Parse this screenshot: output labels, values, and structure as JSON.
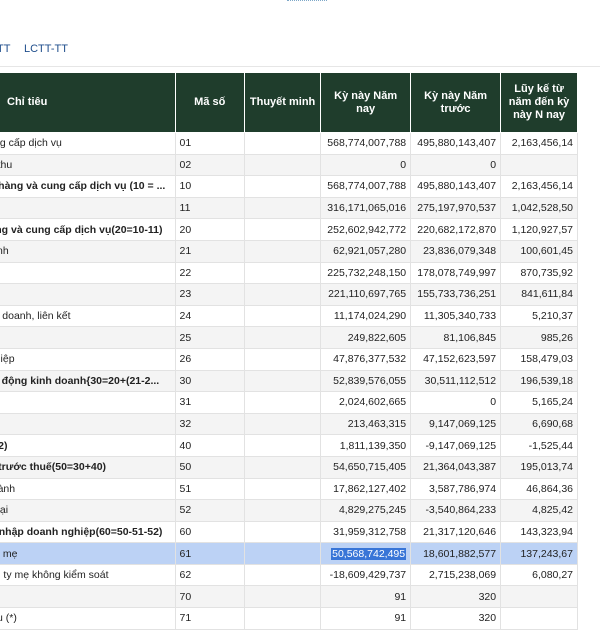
{
  "tabs": [
    "TT",
    "LCTT-TT"
  ],
  "header": {
    "c1": "Chỉ tiêu",
    "c2": "Mã số",
    "c3": "Thuyết minh",
    "c4": "Kỳ này Năm nay",
    "c5": "Kỳ này Năm trước",
    "c6": "Lũy kế từ năm đến kỳ này N nay"
  },
  "rows": [
    {
      "name": "cung cấp dịch vụ",
      "code": "01",
      "note": "",
      "cur": "568,774,007,788",
      "prev": "495,880,143,407",
      "acc": "2,163,456,14",
      "bold": false
    },
    {
      "name": "nh thu",
      "code": "02",
      "note": "",
      "cur": "0",
      "prev": "0",
      "acc": "",
      "bold": false
    },
    {
      "name": "án hàng và cung cấp dịch vụ (10 = ...",
      "code": "10",
      "note": "",
      "cur": "568,774,007,788",
      "prev": "495,880,143,407",
      "acc": "2,163,456,14",
      "bold": true
    },
    {
      "name": "",
      "code": "11",
      "note": "",
      "cur": "316,171,065,016",
      "prev": "275,197,970,537",
      "acc": "1,042,528,50",
      "bold": false
    },
    {
      "name": "hàng và cung cấp dịch vụ(20=10-11)",
      "code": "20",
      "note": "",
      "cur": "252,602,942,772",
      "prev": "220,682,172,870",
      "acc": "1,120,927,57",
      "bold": true
    },
    {
      "name": "chính",
      "code": "21",
      "note": "",
      "cur": "62,921,057,280",
      "prev": "23,836,079,348",
      "acc": "100,601,45",
      "bold": false
    },
    {
      "name": "",
      "code": "22",
      "note": "",
      "cur": "225,732,248,150",
      "prev": "178,078,749,997",
      "acc": "870,735,92",
      "bold": false
    },
    {
      "name": "",
      "code": "23",
      "note": "",
      "cur": "221,110,697,765",
      "prev": "155,733,736,251",
      "acc": "841,611,84",
      "bold": false
    },
    {
      "name": "liên doanh, liên kết",
      "code": "24",
      "note": "",
      "cur": "11,174,024,290",
      "prev": "11,305,340,733",
      "acc": "5,210,37",
      "bold": false
    },
    {
      "name": "",
      "code": "25",
      "note": "",
      "cur": "249,822,605",
      "prev": "81,106,845",
      "acc": "985,26",
      "bold": false
    },
    {
      "name": "nghiệp",
      "code": "26",
      "note": "",
      "cur": "47,876,377,532",
      "prev": "47,152,623,597",
      "acc": "158,479,03",
      "bold": false
    },
    {
      "name": "oạt động kinh doanh{30=20+(21-2...",
      "code": "30",
      "note": "",
      "cur": "52,839,576,055",
      "prev": "30,511,112,512",
      "acc": "196,539,18",
      "bold": true
    },
    {
      "name": "",
      "code": "31",
      "note": "",
      "cur": "2,024,602,665",
      "prev": "0",
      "acc": "5,165,24",
      "bold": false
    },
    {
      "name": "",
      "code": "32",
      "note": "",
      "cur": "213,463,315",
      "prev": "9,147,069,125",
      "acc": "6,690,68",
      "bold": false
    },
    {
      "name": "1-32)",
      "code": "40",
      "note": "",
      "cur": "1,811,139,350",
      "prev": "-9,147,069,125",
      "acc": "-1,525,44",
      "bold": true
    },
    {
      "name": "ần trước thuế(50=30+40)",
      "code": "50",
      "note": "",
      "cur": "54,650,715,405",
      "prev": "21,364,043,387",
      "acc": "195,013,74",
      "bold": true
    },
    {
      "name": "n hành",
      "code": "51",
      "note": "",
      "cur": "17,862,127,402",
      "prev": "3,587,786,974",
      "acc": "46,864,36",
      "bold": false
    },
    {
      "name": "ãn lại",
      "code": "52",
      "note": "",
      "cur": "4,829,275,245",
      "prev": "-3,540,864,233",
      "acc": "4,825,42",
      "bold": false
    },
    {
      "name": "hu nhập doanh nghiệp(60=50-51-52)",
      "code": "60",
      "note": "",
      "cur": "31,959,312,758",
      "prev": "21,317,120,646",
      "acc": "143,323,94",
      "bold": true
    },
    {
      "name": "g ty mẹ",
      "code": "61",
      "note": "",
      "cur": "50,568,742,495",
      "prev": "18,601,882,577",
      "acc": "137,243,67",
      "bold": false,
      "selected": true
    },
    {
      "name": "ông ty mẹ không kiểm soát",
      "code": "62",
      "note": "",
      "cur": "-18,609,429,737",
      "prev": "2,715,238,069",
      "acc": "6,080,27",
      "bold": false
    },
    {
      "name": "u(*)",
      "code": "70",
      "note": "",
      "cur": "91",
      "prev": "320",
      "acc": "",
      "bold": false
    },
    {
      "name": "hiếu (*)",
      "code": "71",
      "note": "",
      "cur": "91",
      "prev": "320",
      "acc": "",
      "bold": false
    }
  ]
}
